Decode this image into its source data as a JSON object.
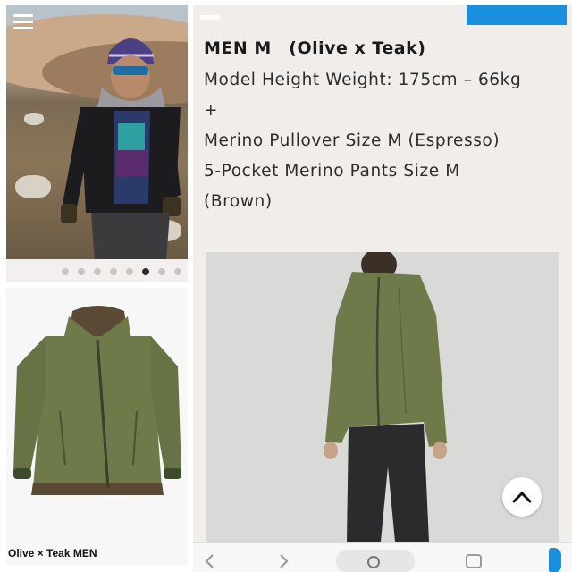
{
  "product": {
    "title": "MEN M　(Olive x Teak)",
    "description_lines": [
      "Model Height Weight: 175cm – 66kg",
      "+",
      "Merino Pullover Size M (Espresso)",
      "5-Pocket Merino Pants Size M",
      "(Brown)"
    ]
  },
  "gallery": {
    "caption": "Olive × Teak MEN",
    "dot_count": 8,
    "active_dot": 6
  },
  "colors": {
    "accent_blue": "#1a8fe0",
    "jacket_olive": "#6f7a4b",
    "panel_bg": "#f1edea"
  },
  "icons": [
    "menu-icon",
    "chevron-up-icon",
    "back-icon",
    "forward-icon",
    "search-icon",
    "tabs-icon"
  ]
}
